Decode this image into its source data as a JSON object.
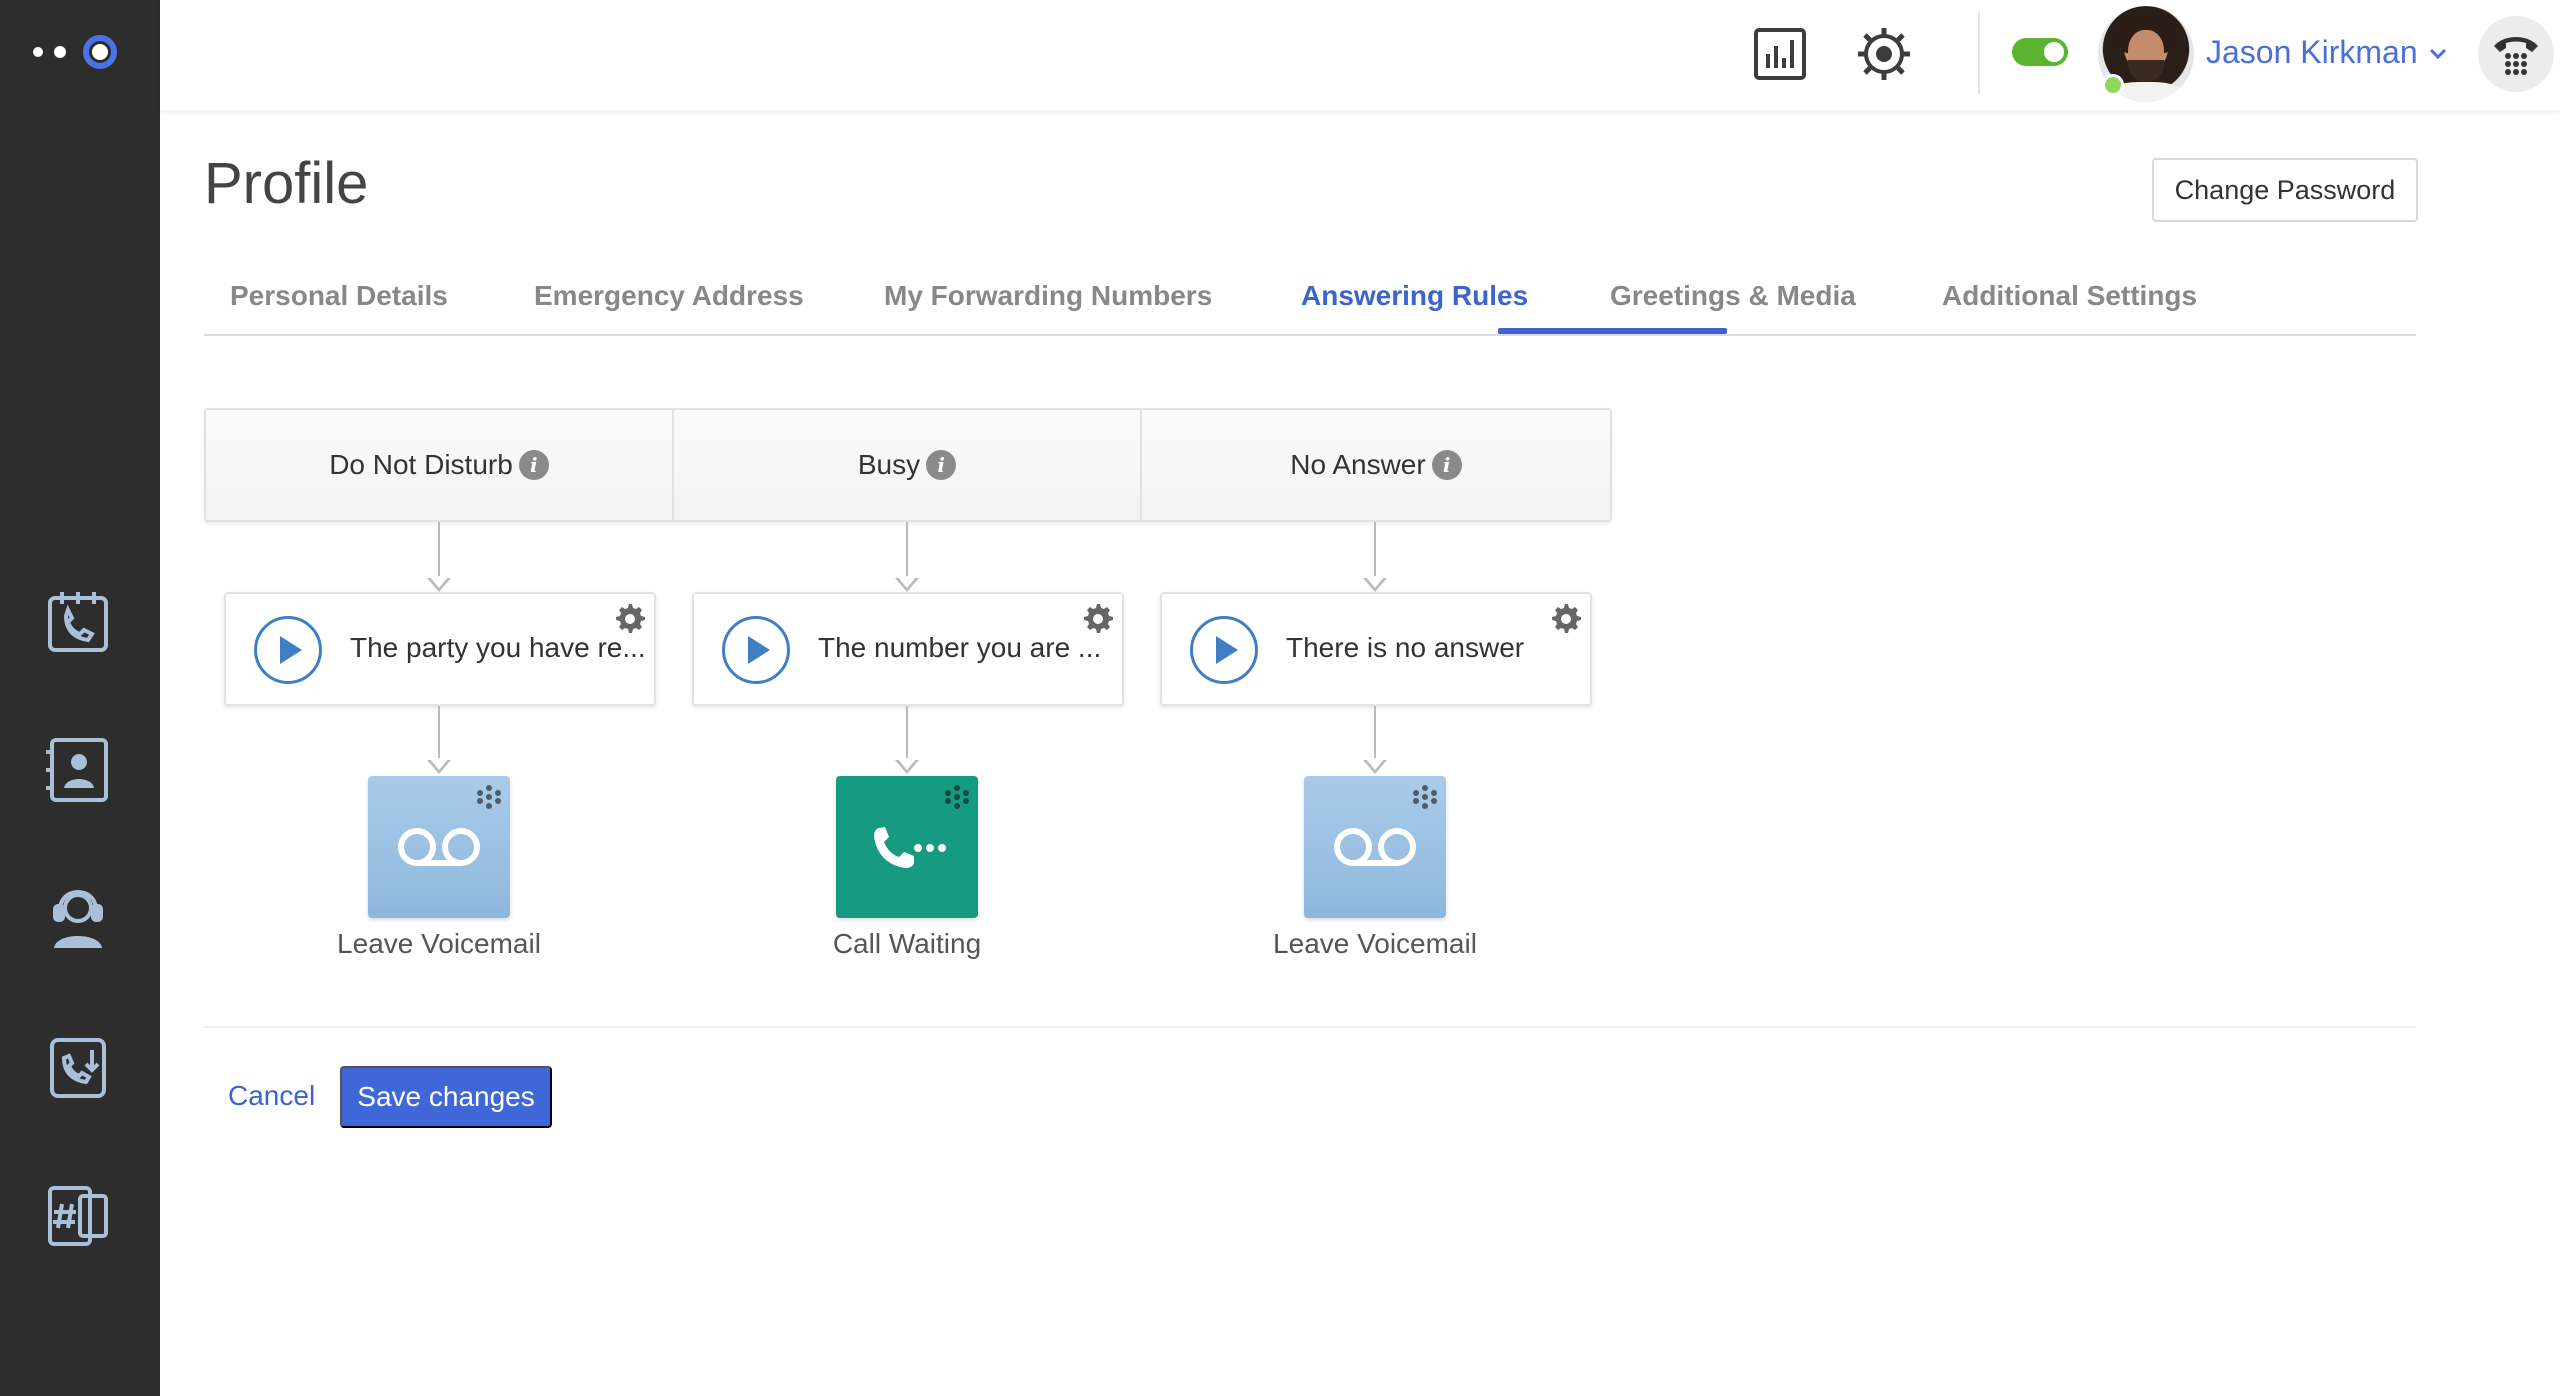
{
  "app": {
    "brand_color": "#3d63d0",
    "sidebar_bg": "#2d2d2d"
  },
  "sidebar": {
    "items": [
      {
        "icon": "calendar-phone-icon"
      },
      {
        "icon": "contacts-book-icon"
      },
      {
        "icon": "agent-headset-icon"
      },
      {
        "icon": "call-transfer-icon"
      },
      {
        "icon": "number-device-icon"
      }
    ]
  },
  "topbar": {
    "icons": [
      "bar-chart-icon",
      "settings-gear-icon",
      "dialpad-icon"
    ],
    "status_toggle": "on",
    "status_color": "#5cb531",
    "user": {
      "name": "Jason Kirkman",
      "presence": "online"
    }
  },
  "page": {
    "title": "Profile",
    "change_password_label": "Change Password"
  },
  "tabs": [
    {
      "label": "Personal Details",
      "active": false
    },
    {
      "label": "Emergency Address",
      "active": false
    },
    {
      "label": "My Forwarding Numbers",
      "active": false
    },
    {
      "label": "Answering Rules",
      "active": true
    },
    {
      "label": "Greetings & Media",
      "active": false
    },
    {
      "label": "Additional Settings",
      "active": false
    }
  ],
  "rules": [
    {
      "condition": "Do Not Disturb",
      "greeting": "The party you have re...",
      "action": "Leave Voicemail",
      "action_type": "voicemail"
    },
    {
      "condition": "Busy",
      "greeting": "The number you are ...",
      "action": "Call Waiting",
      "action_type": "call-waiting"
    },
    {
      "condition": "No Answer",
      "greeting": "There is no answer",
      "action": "Leave Voicemail",
      "action_type": "voicemail"
    }
  ],
  "info_glyph": "i",
  "footer": {
    "cancel_label": "Cancel",
    "save_label": "Save changes"
  }
}
